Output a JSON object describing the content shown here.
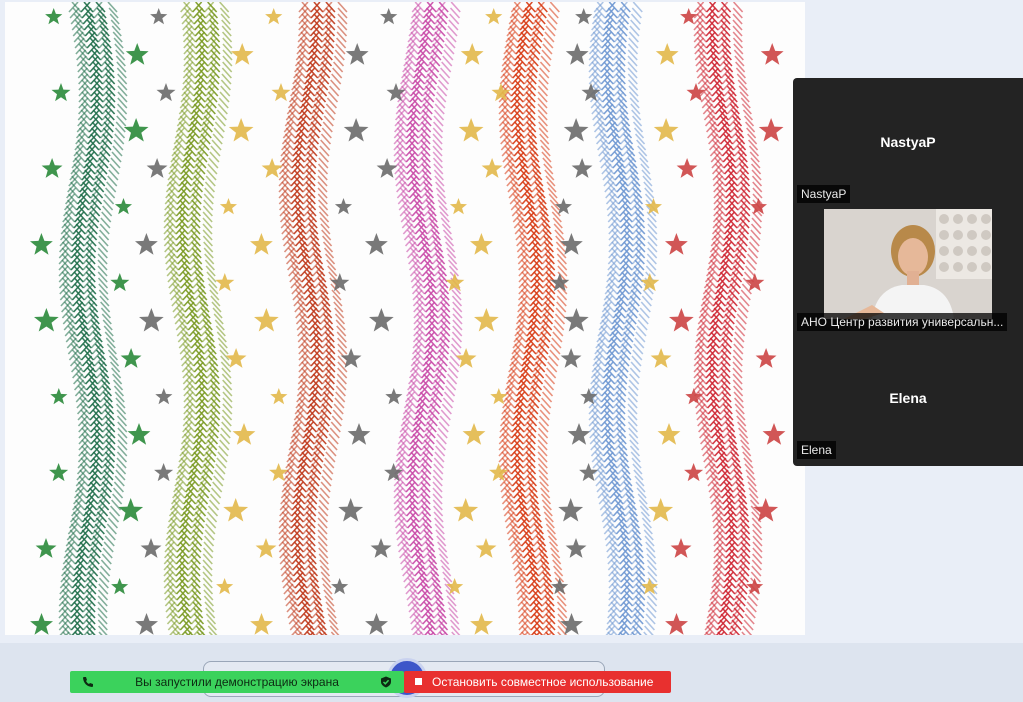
{
  "participants": [
    {
      "display_name": "NastyaP",
      "tag": "NastyaP",
      "video": false
    },
    {
      "display_name": "",
      "tag": "АНО Центр развития универсальн...",
      "video": true
    },
    {
      "display_name": "Elena",
      "tag": "Elena",
      "video": false
    }
  ],
  "share_bar": {
    "status_text": "Вы запустили демонстрацию экрана",
    "stop_label": "Остановить совместное использование"
  },
  "colors": {
    "status_green": "#3bd25c",
    "stop_red": "#e8302f",
    "panel_bg": "#232323"
  },
  "shared_content": {
    "garland_colors": [
      "#1f6e4a",
      "#7a9a22",
      "#c0391b",
      "#c94aa8",
      "#d83a14",
      "#6f98d2",
      "#cf2633"
    ],
    "star_colors": [
      "#e2b84a",
      "#6a6a6a",
      "#c44",
      "#2a8a3a"
    ]
  }
}
